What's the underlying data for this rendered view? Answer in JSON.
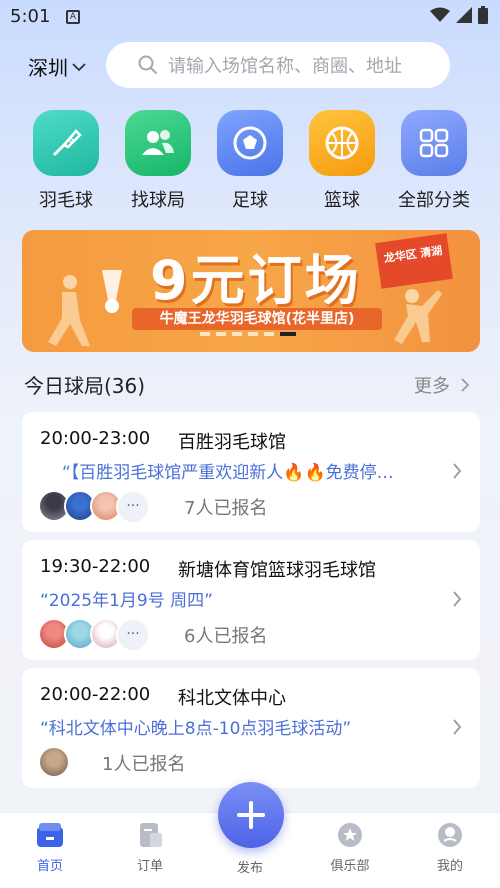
{
  "status": {
    "time": "5:01",
    "a_icon": "A"
  },
  "header": {
    "city": "深圳",
    "search_placeholder": "请输入场馆名称、商圈、地址"
  },
  "categories": [
    {
      "label": "羽毛球",
      "icon": "badminton-icon",
      "color": "#2ec9b0"
    },
    {
      "label": "找球局",
      "icon": "people-icon",
      "color": "#24c27c"
    },
    {
      "label": "足球",
      "icon": "soccer-icon",
      "color": "#5b86f0"
    },
    {
      "label": "篮球",
      "icon": "basketball-icon",
      "color": "#f7a320"
    },
    {
      "label": "全部分类",
      "icon": "grid-icon",
      "color": "#6b8ef2"
    }
  ],
  "banner": {
    "title": "9元订场",
    "subtitle": "牛魔王龙华羽毛球馆(花半里店)",
    "tag": "龙华区 清湖"
  },
  "section": {
    "title": "今日球局(36)",
    "more": "更多"
  },
  "games": [
    {
      "time": "20:00-23:00",
      "venue": "百胜羽毛球馆",
      "desc": "“【百胜羽毛球馆严重欢迎新人🔥🔥免费停…",
      "signup": "7人已报名",
      "more": "···"
    },
    {
      "time": "19:30-22:00",
      "venue": "新塘体育馆篮球羽毛球馆",
      "desc": "“2025年1月9号 周四”",
      "signup": "6人已报名",
      "more": "···"
    },
    {
      "time": "20:00-22:00",
      "venue": "科北文体中心",
      "desc": "“科北文体中心晚上8点-10点羽毛球活动”",
      "signup": "1人已报名"
    }
  ],
  "tabbar": {
    "home": "首页",
    "orders": "订单",
    "publish": "发布",
    "club": "俱乐部",
    "mine": "我的"
  },
  "colors": {
    "accent": "#3b64e8",
    "link": "#4b6fd8",
    "banner": "#f59a3f"
  }
}
